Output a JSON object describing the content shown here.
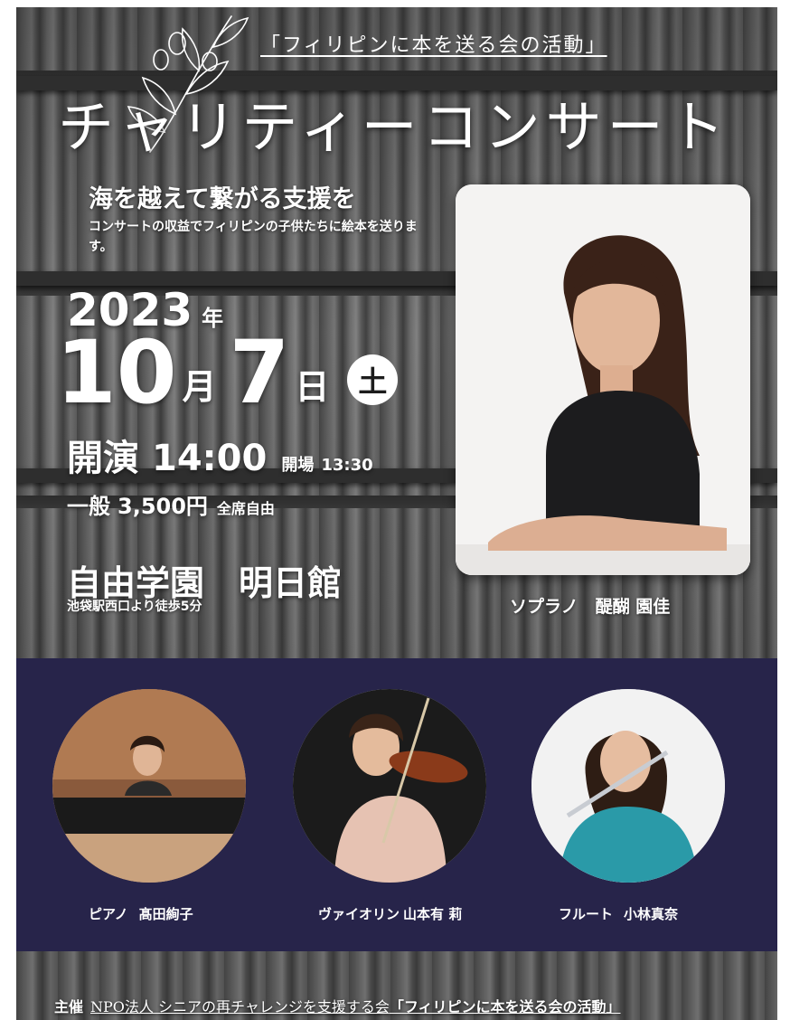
{
  "header": {
    "org_activity": "「フィリピンに本を送る会の活動」",
    "title": "チャリティーコンサート",
    "tagline": "海を越えて繋がる支援を",
    "description": "コンサートの収益でフィリピンの子供たちに絵本を送ります。"
  },
  "event": {
    "year": "2023",
    "year_unit": "年",
    "month": "10",
    "month_unit": "月",
    "day": "7",
    "day_unit": "日",
    "weekday": "土",
    "start_label": "開演",
    "start_time": "14:00",
    "doors_label": "開場",
    "doors_time": "13:30",
    "price_label": "一般",
    "price": "3,500円",
    "seating": "全席自由",
    "venue": "自由学園　明日館",
    "access": "池袋駅西口より徒歩5分"
  },
  "featured": {
    "caption": "ソプラノ　醍醐 園佳"
  },
  "performers": [
    {
      "instrument": "ピアノ",
      "name": "髙田絢子"
    },
    {
      "instrument": "ヴァイオリン",
      "name": "山本有 莉"
    },
    {
      "instrument": "フルート",
      "name": "小林真奈"
    }
  ],
  "footer": {
    "label": "主催",
    "organizer": "NPO法人 シニアの再チャレンジを支援する会",
    "activity": "「フィリピンに本を送る会の活動」"
  }
}
